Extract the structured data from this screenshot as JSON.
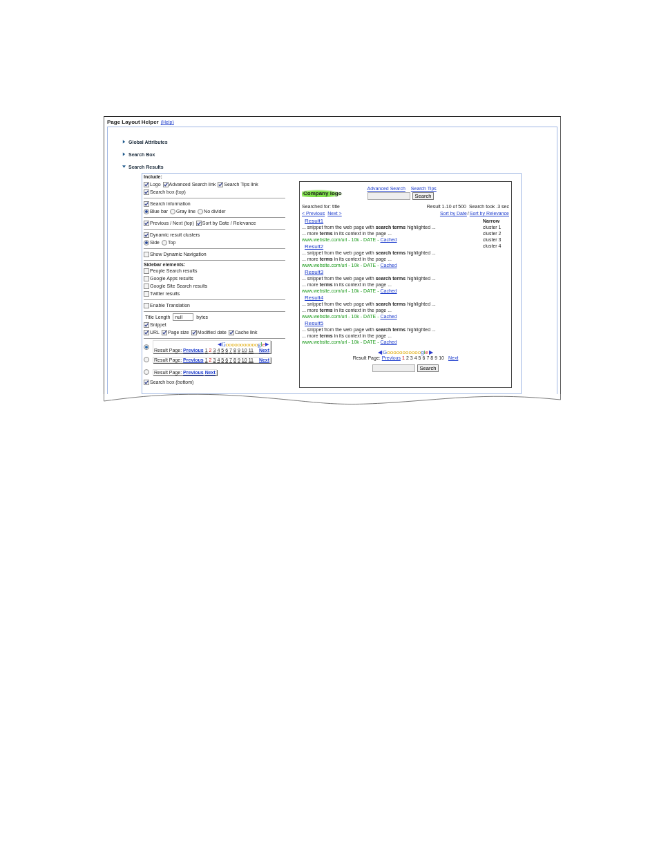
{
  "panel": {
    "title": "Page Layout Helper",
    "help_link": "(Help)",
    "sections": [
      {
        "label": "Global Attributes",
        "expanded": false
      },
      {
        "label": "Search Box",
        "expanded": false
      },
      {
        "label": "Search Results",
        "expanded": true
      }
    ],
    "include_heading": "Include:",
    "groups": [
      {
        "rows": [
          [
            {
              "kind": "checkbox",
              "label": "Logo",
              "checked": true
            },
            {
              "kind": "checkbox",
              "label": "Advanced Search link",
              "checked": true
            },
            {
              "kind": "checkbox",
              "label": "Search Tips link",
              "checked": true
            }
          ],
          [
            {
              "kind": "checkbox",
              "label": "Search box (top)",
              "checked": true
            }
          ]
        ]
      },
      {
        "rows": [
          [
            {
              "kind": "checkbox",
              "label": "Search information",
              "checked": true
            }
          ],
          [
            {
              "kind": "radio",
              "label": "Blue bar",
              "selected": true
            },
            {
              "kind": "radio",
              "label": "Gray line",
              "selected": false
            },
            {
              "kind": "radio",
              "label": "No divider",
              "selected": false
            }
          ]
        ]
      },
      {
        "rows": [
          [
            {
              "kind": "checkbox",
              "label": "Previous / Next (top)",
              "checked": true
            },
            {
              "kind": "checkbox",
              "label": "Sort by Date / Relevance",
              "checked": true
            }
          ]
        ]
      },
      {
        "rows": [
          [
            {
              "kind": "checkbox",
              "label": "Dynamic result clusters",
              "checked": true
            }
          ],
          [
            {
              "kind": "radio",
              "label": "Side",
              "selected": true
            },
            {
              "kind": "radio",
              "label": "Top",
              "selected": false
            }
          ]
        ]
      },
      {
        "rows": [
          [
            {
              "kind": "checkbox",
              "label": "Show Dynamic Navigation",
              "checked": false
            }
          ]
        ]
      },
      {
        "heading": "Sidebar elements:",
        "rows": [
          [
            {
              "kind": "checkbox",
              "label": "People Search results",
              "checked": false
            }
          ],
          [
            {
              "kind": "checkbox",
              "label": "Google Apps results",
              "checked": false
            }
          ],
          [
            {
              "kind": "checkbox",
              "label": "Google Site Search results",
              "checked": false
            }
          ],
          [
            {
              "kind": "checkbox",
              "label": "Twitter results",
              "checked": false
            }
          ]
        ]
      },
      {
        "rows": [
          [
            {
              "kind": "checkbox",
              "label": "Enable Translation",
              "checked": false
            }
          ]
        ]
      },
      {
        "rows": [
          [
            {
              "kind": "field",
              "label": "Title Length",
              "value": "null",
              "suffix": "bytes"
            }
          ],
          [
            {
              "kind": "checkbox",
              "label": "Snippet",
              "checked": true
            }
          ],
          [
            {
              "kind": "checkbox",
              "label": "URL",
              "checked": true
            },
            {
              "kind": "checkbox",
              "label": "Page size",
              "checked": true
            },
            {
              "kind": "checkbox",
              "label": "Modified date",
              "checked": true
            },
            {
              "kind": "checkbox",
              "label": "Cache link",
              "checked": true
            }
          ]
        ]
      },
      {
        "rows": [
          [
            {
              "kind": "pager",
              "selected": true,
              "arrow_left": "◀",
              "logo": "Gooooooooooogle",
              "arrow_right": "▶",
              "label": "Result Page:",
              "previous": "Previous",
              "next": "Next",
              "pages": [
                {
                  "label": "1",
                  "selected": false
                },
                {
                  "label": "2",
                  "selected": true
                },
                {
                  "label": "3",
                  "selected": false
                },
                {
                  "label": "4",
                  "selected": false
                },
                {
                  "label": "5",
                  "selected": false
                },
                {
                  "label": "6",
                  "selected": false
                },
                {
                  "label": "7",
                  "selected": false
                },
                {
                  "label": "8",
                  "selected": false
                },
                {
                  "label": "9",
                  "selected": false
                },
                {
                  "label": "10",
                  "selected": false
                },
                {
                  "label": "11",
                  "selected": false
                }
              ]
            }
          ],
          [
            {
              "kind": "pager",
              "selected": false,
              "label": "Result Page:",
              "previous": "Previous",
              "next": "Next",
              "pages": [
                {
                  "label": "1",
                  "selected": false
                },
                {
                  "label": "2",
                  "selected": true
                },
                {
                  "label": "3",
                  "selected": false
                },
                {
                  "label": "4",
                  "selected": false
                },
                {
                  "label": "5",
                  "selected": false
                },
                {
                  "label": "6",
                  "selected": false
                },
                {
                  "label": "7",
                  "selected": false
                },
                {
                  "label": "8",
                  "selected": false
                },
                {
                  "label": "9",
                  "selected": false
                },
                {
                  "label": "10",
                  "selected": false
                },
                {
                  "label": "11",
                  "selected": false
                }
              ]
            }
          ],
          [
            {
              "kind": "pager",
              "selected": false,
              "label": "Result Page:",
              "previous": "Previous",
              "next": "Next"
            }
          ],
          [
            {
              "kind": "checkbox",
              "label": "Search box (bottom)",
              "checked": true
            }
          ]
        ]
      }
    ]
  },
  "preview": {
    "logo": "Company logo",
    "links": [
      "Advanced Search",
      "Search Tips"
    ],
    "search_button": "Search",
    "searched_for": "Searched for: title",
    "result_count": "Result 1-10 of 500",
    "search_time": "Search took .3 sec",
    "previous": "< Previous",
    "next": "Next >",
    "sort_links": [
      "Sort by Date",
      "Sort by Relevance"
    ],
    "sort_separator": "/",
    "sidebar_heading": "Narrow",
    "clusters": [
      "cluster 1",
      "cluster 2",
      "cluster 3",
      "cluster 4"
    ],
    "results": [
      {
        "title": "Result1",
        "snippet": [
          "... snippet from the web page with **search terms** highlighted ...",
          "... more **terms** in its context in the page ..."
        ],
        "url": "www.website.com/url - 10k - DATE -",
        "cached": "Cached"
      },
      {
        "title": "Result2",
        "snippet": [
          "... snippet from the web page with **search terms** highlighted ...",
          "... more **terms** in its context in the page ..."
        ],
        "url": "www.website.com/url - 10k - DATE -",
        "cached": "Cached"
      },
      {
        "title": "Result3",
        "snippet": [
          "... snippet from the web page with **search terms** highlighted ...",
          "... more **terms** in its context in the page ..."
        ],
        "url": "www.website.com/url - 10k - DATE -",
        "cached": "Cached"
      },
      {
        "title": "Result4",
        "snippet": [
          "... snippet from the web page with **search terms** highlighted ...",
          "... more **terms** in its context in the page ..."
        ],
        "url": "www.website.com/url - 10k - DATE -",
        "cached": "Cached"
      },
      {
        "title": "Result5",
        "snippet": [
          "... snippet from the web page with **search terms** highlighted ...",
          "... more **terms** in its context in the page ..."
        ],
        "url": "www.website.com/url - 10k - DATE -",
        "cached": "Cached"
      }
    ],
    "pager": {
      "arrow_left": "◀",
      "logo": "Gooooooooooogle",
      "arrow_right": "▶",
      "label": "Result Page:",
      "previous": "Previous",
      "next": "Next",
      "pages": [
        {
          "label": "1",
          "selected": true
        },
        {
          "label": "2",
          "selected": false
        },
        {
          "label": "3",
          "selected": false
        },
        {
          "label": "4",
          "selected": false
        },
        {
          "label": "5",
          "selected": false
        },
        {
          "label": "6",
          "selected": false
        },
        {
          "label": "7",
          "selected": false
        },
        {
          "label": "8",
          "selected": false
        },
        {
          "label": "9",
          "selected": false
        },
        {
          "label": "10",
          "selected": false
        }
      ]
    },
    "bottom_search_button": "Search"
  }
}
